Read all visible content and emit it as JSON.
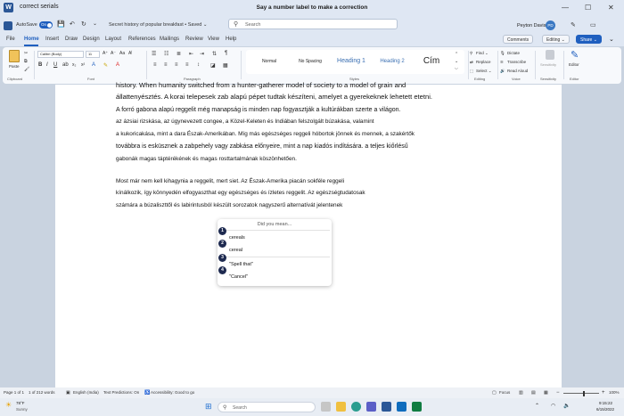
{
  "window": {
    "app_title": "correct serials",
    "doc_title": "Say a number label to make a correction",
    "minimize": "—",
    "maximize": "☐",
    "close": "✕"
  },
  "qat": {
    "autosave_label": "AutoSave",
    "autosave_toggle": "On",
    "doc_name": "Secret history of popular breakfast • Saved ⌄",
    "search_placeholder": "Search",
    "user_name": "Peyton Davis",
    "user_initials": "PD"
  },
  "tabs": [
    "File",
    "Home",
    "Insert",
    "Draw",
    "Design",
    "Layout",
    "References",
    "Mailings",
    "Review",
    "View",
    "Help"
  ],
  "active_tab": "Home",
  "actions": {
    "comments": "Comments",
    "editing": "Editing ⌄",
    "share": "Share ⌄"
  },
  "ribbon": {
    "clipboard": {
      "paste": "Paste",
      "label": "Clipboard"
    },
    "font": {
      "name": "Calibri (Body)",
      "size": "11",
      "label": "Font"
    },
    "paragraph": {
      "label": "Paragraph"
    },
    "styles": {
      "items": [
        "Normal",
        "No Spacing",
        "Heading 1",
        "Heading 2",
        "Cím"
      ],
      "label": "Styles"
    },
    "editing": {
      "find": "Find ⌄",
      "replace": "Replace",
      "select": "Select ⌄",
      "label": "Editing"
    },
    "voice": {
      "dictate": "Dictate",
      "transcribe": "Transcribe",
      "read_aloud": "Read Aloud",
      "label": "Voice"
    },
    "sensitivity": {
      "button": "Sensitivity",
      "label": "Sensitivity"
    },
    "editor": {
      "button": "Editor",
      "label": "Editor"
    }
  },
  "document": {
    "lines": [
      "history. When humanity switched from a hunter-gatherer model of society to a model of grain and",
      "állattenyésztés. A korai telepesek zab alapú pépet tudtak készíteni, amelyet a gyerekeknek lehetett etetni.",
      "A forró gabona alapú reggelit még manapság is minden nap fogyasztják a kultúrákban szerte a világon.",
      "az ázsiai rizskása, az úgynevezett congee, a Közel-Keleten és Indiában felszolgált búzakása, valamint",
      "a kukoricakása, mint a dara Észak-Amerikában. Míg más egészséges reggeli hóbortok jönnek és mennek, a szakértők",
      "továbbra is esküsznek a zabpehely vagy zabkása előnyeire, mint a nap kiadós indítására. a teljes kiőrlésű",
      "gabonák magas táptérékének és magas rosttartalmának köszönhetően.",
      "Most már nem kell kihagynia a reggelit, mert siet. Az Észak-Amerika piacán sokféle reggeli",
      "kínálkozik, így könnyedén elfogyaszthat egy egészséges és ízletes reggelit. Az egészségtudatosak",
      "számára a búzaliszttől és labirintusból készült sorozatok nagyszerű alternatívát jelentenek"
    ]
  },
  "popup": {
    "header": "Did you mean...",
    "items": [
      {
        "num": "1",
        "text": "cereals"
      },
      {
        "num": "2",
        "text": "cereal"
      },
      {
        "num": "3",
        "text": "\"Spell that\""
      },
      {
        "num": "4",
        "text": "\"Cancel\""
      }
    ]
  },
  "status": {
    "page": "Page 1 of 1",
    "words": "1 of 212 words",
    "language": "English (India)",
    "text_predictions": "Text Predictions: On",
    "accessibility": "Accessibility: Good to go",
    "focus": "Focus",
    "zoom": "100%"
  },
  "taskbar": {
    "weather_temp": "78°F",
    "weather_desc": "Sunny",
    "search_placeholder": "Search",
    "time": "9:15:22",
    "date": "6/15/2022"
  },
  "colors": {
    "accent": "#1f5fbf",
    "badge": "#1e2a50",
    "doc_background": "#c9d3e0"
  }
}
